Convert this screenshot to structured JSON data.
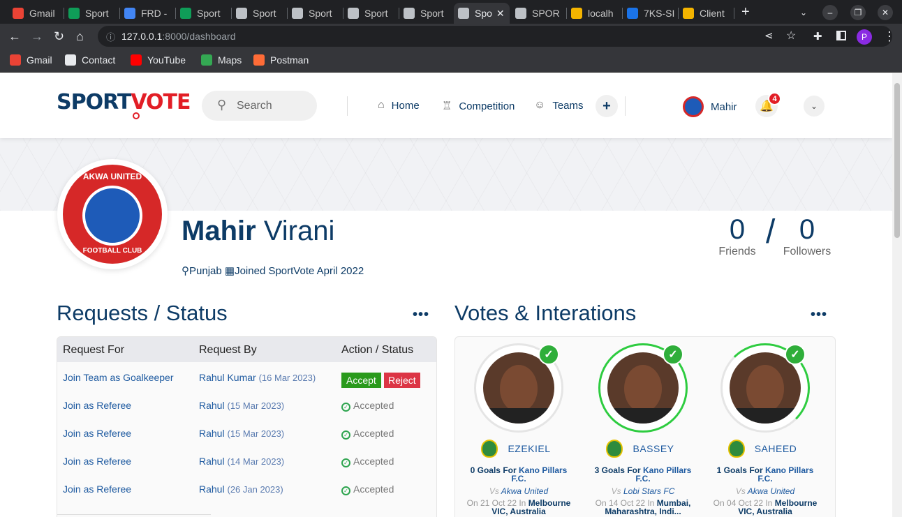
{
  "browser": {
    "tabs": [
      {
        "label": "Gmail",
        "color": "#ea4335"
      },
      {
        "label": "Sport",
        "color": "#0f9d58"
      },
      {
        "label": "FRD -",
        "color": "#4285f4"
      },
      {
        "label": "Sport",
        "color": "#0f9d58"
      },
      {
        "label": "Sport",
        "color": "#bdc1c6"
      },
      {
        "label": "Sport",
        "color": "#bdc1c6"
      },
      {
        "label": "Sport",
        "color": "#bdc1c6"
      },
      {
        "label": "Sport",
        "color": "#bdc1c6"
      },
      {
        "label": "Spo",
        "color": "#bdc1c6",
        "active": true
      },
      {
        "label": "SPOR",
        "color": "#bdc1c6"
      },
      {
        "label": "localh",
        "color": "#f4b400"
      },
      {
        "label": "7KS-SI",
        "color": "#1a73e8"
      },
      {
        "label": "Client",
        "color": "#f4b400"
      }
    ],
    "url_host": "127.0.0.1",
    "url_path": ":8000/dashboard",
    "profile_initial": "P",
    "bookmarks": [
      {
        "label": "Gmail",
        "color": "#ea4335"
      },
      {
        "label": "Contact",
        "color": "#e8eaed"
      },
      {
        "label": "YouTube",
        "color": "#ff0000"
      },
      {
        "label": "Maps",
        "color": "#34a853"
      },
      {
        "label": "Postman",
        "color": "#ff6c37"
      }
    ]
  },
  "header": {
    "logo_left": "SPORT",
    "logo_right": "VOTE",
    "search_placeholder": "Search",
    "nav": [
      {
        "label": "Home",
        "icon": "home-icon"
      },
      {
        "label": "Competition",
        "icon": "trophy-icon"
      },
      {
        "label": "Teams",
        "icon": "users-icon"
      }
    ],
    "user_name": "Mahir",
    "notification_count": "4"
  },
  "profile": {
    "club_name_top": "AKWA UNITED",
    "club_name_bottom": "FOOTBALL CLUB",
    "first_name": "Mahir",
    "last_name": "Virani",
    "location": "Punjab",
    "joined": "Joined SportVote April 2022",
    "friends_count": "0",
    "friends_label": "Friends",
    "followers_count": "0",
    "followers_label": "Followers"
  },
  "requests": {
    "title": "Requests / Status",
    "columns": [
      "Request For",
      "Request By",
      "Action / Status"
    ],
    "accept_label": "Accept",
    "reject_label": "Reject",
    "rows": [
      {
        "for": "Join Team as Goalkeeper",
        "by": "Rahul Kumar",
        "date": "(16 Mar 2023)",
        "status": ""
      },
      {
        "for": "Join as Referee",
        "by": "Rahul",
        "date": "(15 Mar 2023)",
        "status": "Accepted"
      },
      {
        "for": "Join as Referee",
        "by": "Rahul",
        "date": "(15 Mar 2023)",
        "status": "Accepted"
      },
      {
        "for": "Join as Referee",
        "by": "Rahul",
        "date": "(14 Mar 2023)",
        "status": "Accepted"
      },
      {
        "for": "Join as Referee",
        "by": "Rahul",
        "date": "(26 Jan 2023)",
        "status": "Accepted"
      }
    ]
  },
  "votes": {
    "title": "Votes & Interations",
    "players": [
      {
        "name": "EZEKIEL",
        "goals": "0 Goals For",
        "team": "Kano Pillars F.C.",
        "vs_prefix": "Vs",
        "vs": "Akwa United",
        "on": "On 21 Oct 22 In",
        "place": "Melbourne VIC, Australia",
        "ring": "none"
      },
      {
        "name": "BASSEY",
        "goals": "3 Goals For",
        "team": "Kano Pillars F.C.",
        "vs_prefix": "Vs",
        "vs": "Lobi Stars FC",
        "on": "On 14 Oct 22 In",
        "place": "Mumbai, Maharashtra, Indi...",
        "ring": "full"
      },
      {
        "name": "SAHEED",
        "goals": "1 Goals For",
        "team": "Kano Pillars F.C.",
        "vs_prefix": "Vs",
        "vs": "Akwa United",
        "on": "On 04 Oct 22 In",
        "place": "Melbourne VIC, Australia",
        "ring": "part"
      }
    ]
  }
}
